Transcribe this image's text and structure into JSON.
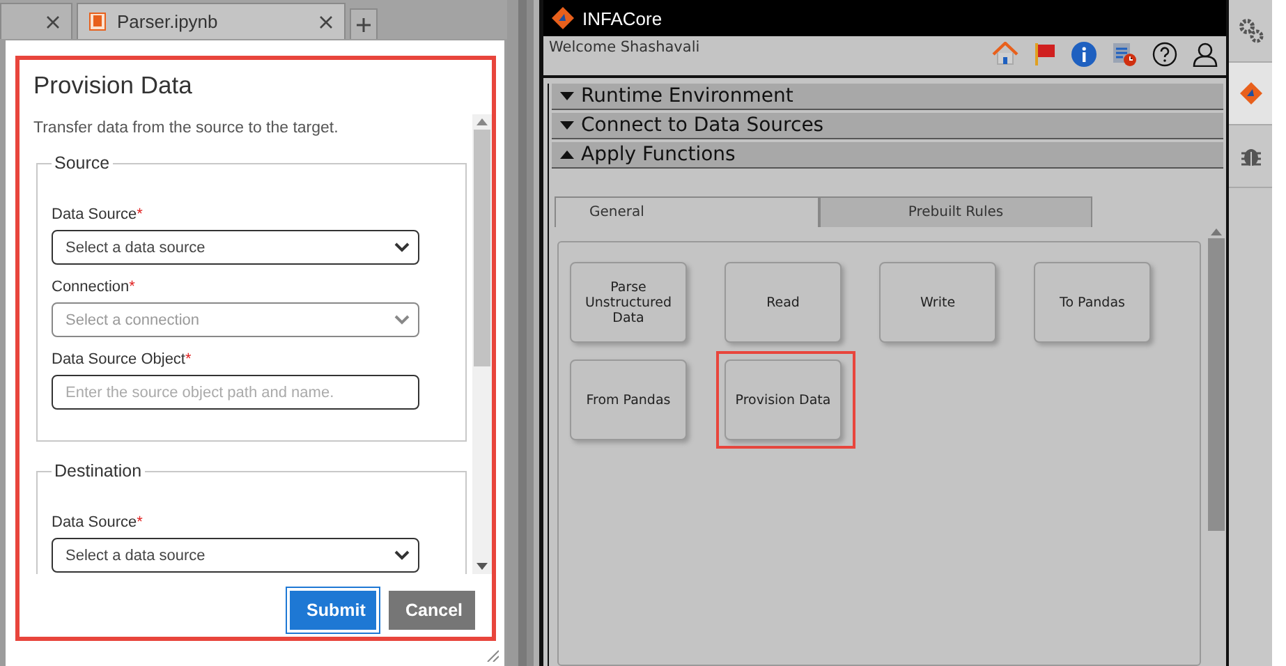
{
  "browser_tabs": [
    {
      "selected": false
    },
    {
      "label": "Parser.ipynb",
      "selected": true
    }
  ],
  "dialog": {
    "title": "Provision Data",
    "description": "Transfer data from the source to the target.",
    "highlighted": true,
    "sections": [
      {
        "legend": "Source",
        "fields": [
          {
            "kind": "select",
            "label": "Data Source",
            "required_mark": "*",
            "placeholder": "Select a data source",
            "disabled": false
          },
          {
            "kind": "select",
            "label": "Connection",
            "required_mark": "*",
            "placeholder": "Select a connection",
            "disabled": true
          },
          {
            "kind": "text",
            "label": "Data Source Object",
            "required_mark": "*",
            "placeholder": "Enter the source object path and name.",
            "disabled": false
          }
        ]
      },
      {
        "legend": "Destination",
        "fields": [
          {
            "kind": "select",
            "label": "Data Source",
            "required_mark": "*",
            "placeholder": "Select a data source",
            "disabled": false
          }
        ]
      }
    ],
    "buttons": [
      {
        "label": "Submit",
        "kind": "primary"
      },
      {
        "label": "Cancel",
        "kind": "secondary"
      }
    ]
  },
  "app": {
    "title": "INFACore",
    "welcome": "Welcome Shashavali",
    "sections": [
      {
        "label": "Runtime Environment",
        "expanded": false
      },
      {
        "label": "Connect to Data Sources",
        "expanded": false
      },
      {
        "label": "Apply Functions",
        "expanded": true
      }
    ],
    "tabs": [
      {
        "label": "General",
        "selected": true
      },
      {
        "label": "Prebuilt Rules",
        "selected": false
      }
    ],
    "functions": [
      {
        "label": "Parse Unstructured Data",
        "highlighted": false
      },
      {
        "label": "Read",
        "highlighted": false
      },
      {
        "label": "Write",
        "highlighted": false
      },
      {
        "label": "To Pandas",
        "highlighted": false
      },
      {
        "label": "From Pandas",
        "highlighted": false
      },
      {
        "label": "Provision Data",
        "highlighted": true
      }
    ]
  },
  "side_panel": [
    {
      "kind": "settings",
      "selected": false
    },
    {
      "kind": "logo",
      "selected": true
    },
    {
      "kind": "debug",
      "selected": false
    }
  ]
}
